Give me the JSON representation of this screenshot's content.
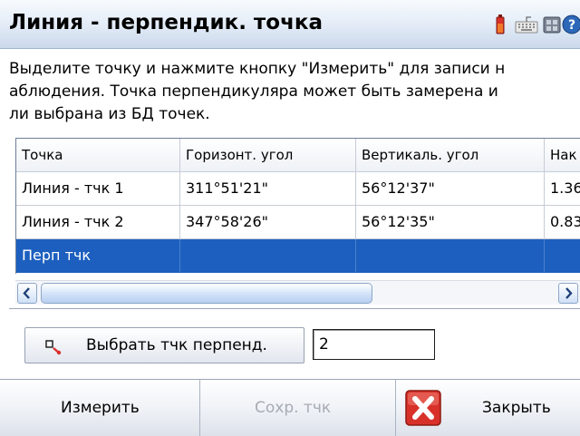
{
  "window": {
    "title": "Линия - перпендик. точка"
  },
  "instructions": {
    "line1": "Выделите точку и нажмите кнопку \"Измерить\" для записи н",
    "line2": "аблюдения. Точка перпендикуляра может быть замерена и",
    "line3": "ли выбрана из БД точек."
  },
  "table": {
    "columns": [
      "Точка",
      "Горизонт. угол",
      "Вертикаль. угол",
      "Нак"
    ],
    "rows": [
      [
        "Линия - тчк 1",
        "311°51'21\"",
        "56°12'37\"",
        "1.36"
      ],
      [
        "Линия - тчк 2",
        "347°58'26\"",
        "56°12'35\"",
        "0.83"
      ],
      [
        "Перп тчк",
        "",
        "",
        ""
      ]
    ],
    "selected_row": 3
  },
  "pick_button": {
    "label": "Выбрать тчк перпенд."
  },
  "point_field": {
    "value": "2"
  },
  "bottom_bar": {
    "measure_label": "Измерить",
    "store_label": "Сохр. тчк",
    "close_label": "Закрыть"
  },
  "icons": {
    "tray": [
      "battery-icon",
      "keyboard-icon",
      "network-icon",
      "help-icon"
    ],
    "pick": "pick-point-icon",
    "close": "close-x-icon"
  },
  "colors": {
    "selection": "#1c5fbf",
    "close_red": "#d8312a",
    "disabled_text": "#a7abb3"
  }
}
